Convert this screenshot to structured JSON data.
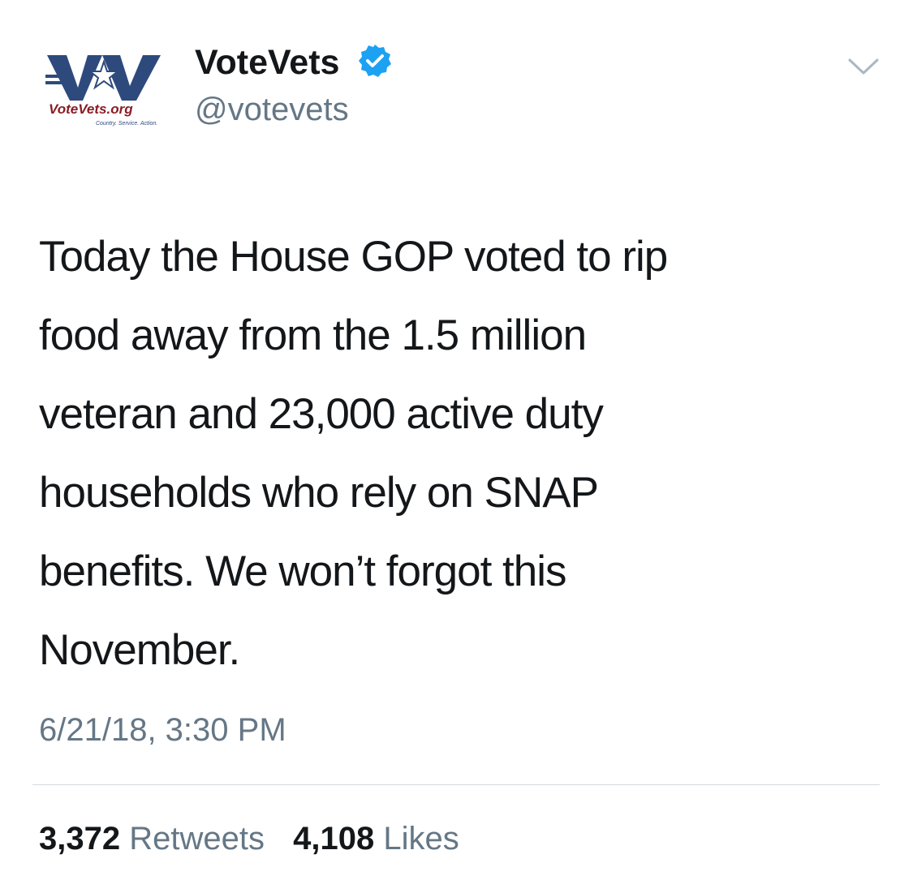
{
  "user": {
    "display_name": "VoteVets",
    "handle": "@votevets",
    "verified": true,
    "avatar_text": "VoteVets.org",
    "avatar_tagline": "Country. Service. Action."
  },
  "tweet": {
    "text": "Today the House GOP voted to rip\nfood away from the 1.5 million\nveteran and 23,000 active duty\nhouseholds who rely on SNAP\nbenefits. We won’t forgot this\nNovember.",
    "timestamp": "6/21/18, 3:30 PM"
  },
  "stats": {
    "retweets_count": "3,372",
    "retweets_label": "Retweets",
    "likes_count": "4,108",
    "likes_label": "Likes"
  },
  "colors": {
    "text_primary": "#14171a",
    "text_secondary": "#657786",
    "verified_blue": "#1da1f2",
    "logo_navy": "#2e4a7d",
    "logo_red": "#8b1c24",
    "divider": "#d6dadd"
  },
  "icons": {
    "verified": "verified-badge-icon",
    "caret": "chevron-down-icon"
  }
}
